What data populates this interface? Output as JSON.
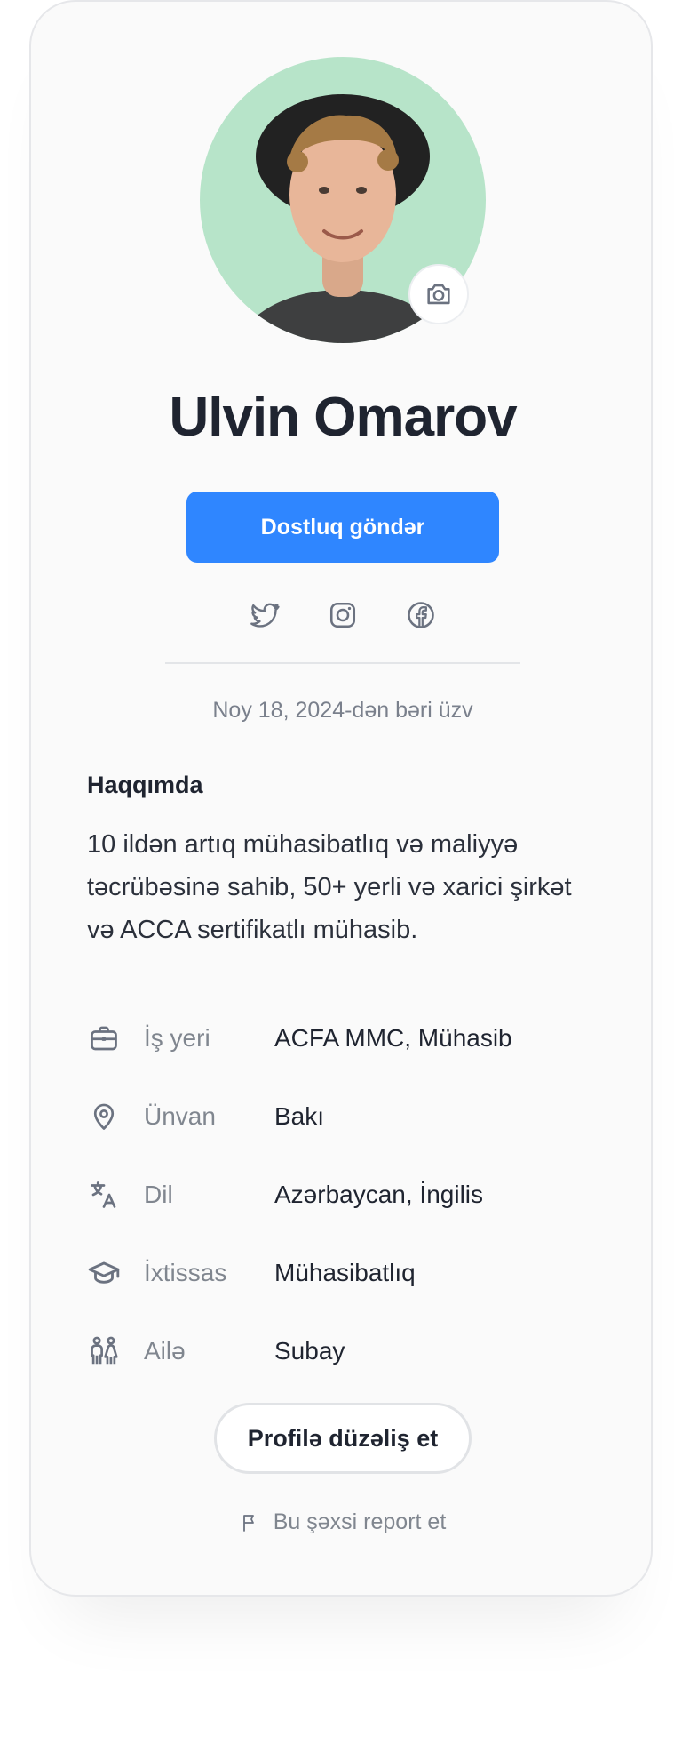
{
  "profile": {
    "name": "Ulvin Omarov",
    "primary_action": "Dostluq göndər",
    "member_since": "Noy 18, 2024-dən bəri üzv",
    "about_title": "Haqqımda",
    "about_text": "10 ildən artıq mühasibatlıq və maliyyə təcrübəsinə sahib, 50+ yerli və xarici şirkət və ACCA sertifikatlı mühasib.",
    "edit_label": "Profilə düzəliş et",
    "report_label": "Bu şəxsi report et"
  },
  "socials": [
    {
      "icon": "twitter-icon"
    },
    {
      "icon": "instagram-icon"
    },
    {
      "icon": "facebook-icon"
    }
  ],
  "details": [
    {
      "icon": "briefcase-icon",
      "label": "İş yeri",
      "value": "ACFA MMC, Mühasib"
    },
    {
      "icon": "map-pin-icon",
      "label": "Ünvan",
      "value": "Bakı"
    },
    {
      "icon": "translate-icon",
      "label": "Dil",
      "value": "Azərbaycan, İngilis"
    },
    {
      "icon": "graduation-cap-icon",
      "label": "İxtissas",
      "value": "Mühasibatlıq"
    },
    {
      "icon": "family-icon",
      "label": "Ailə",
      "value": "Subay"
    }
  ],
  "colors": {
    "accent": "#2f86ff",
    "avatar_bg": "#b7e4c9",
    "muted_text": "#80868f",
    "card_bg": "#fafafa"
  }
}
